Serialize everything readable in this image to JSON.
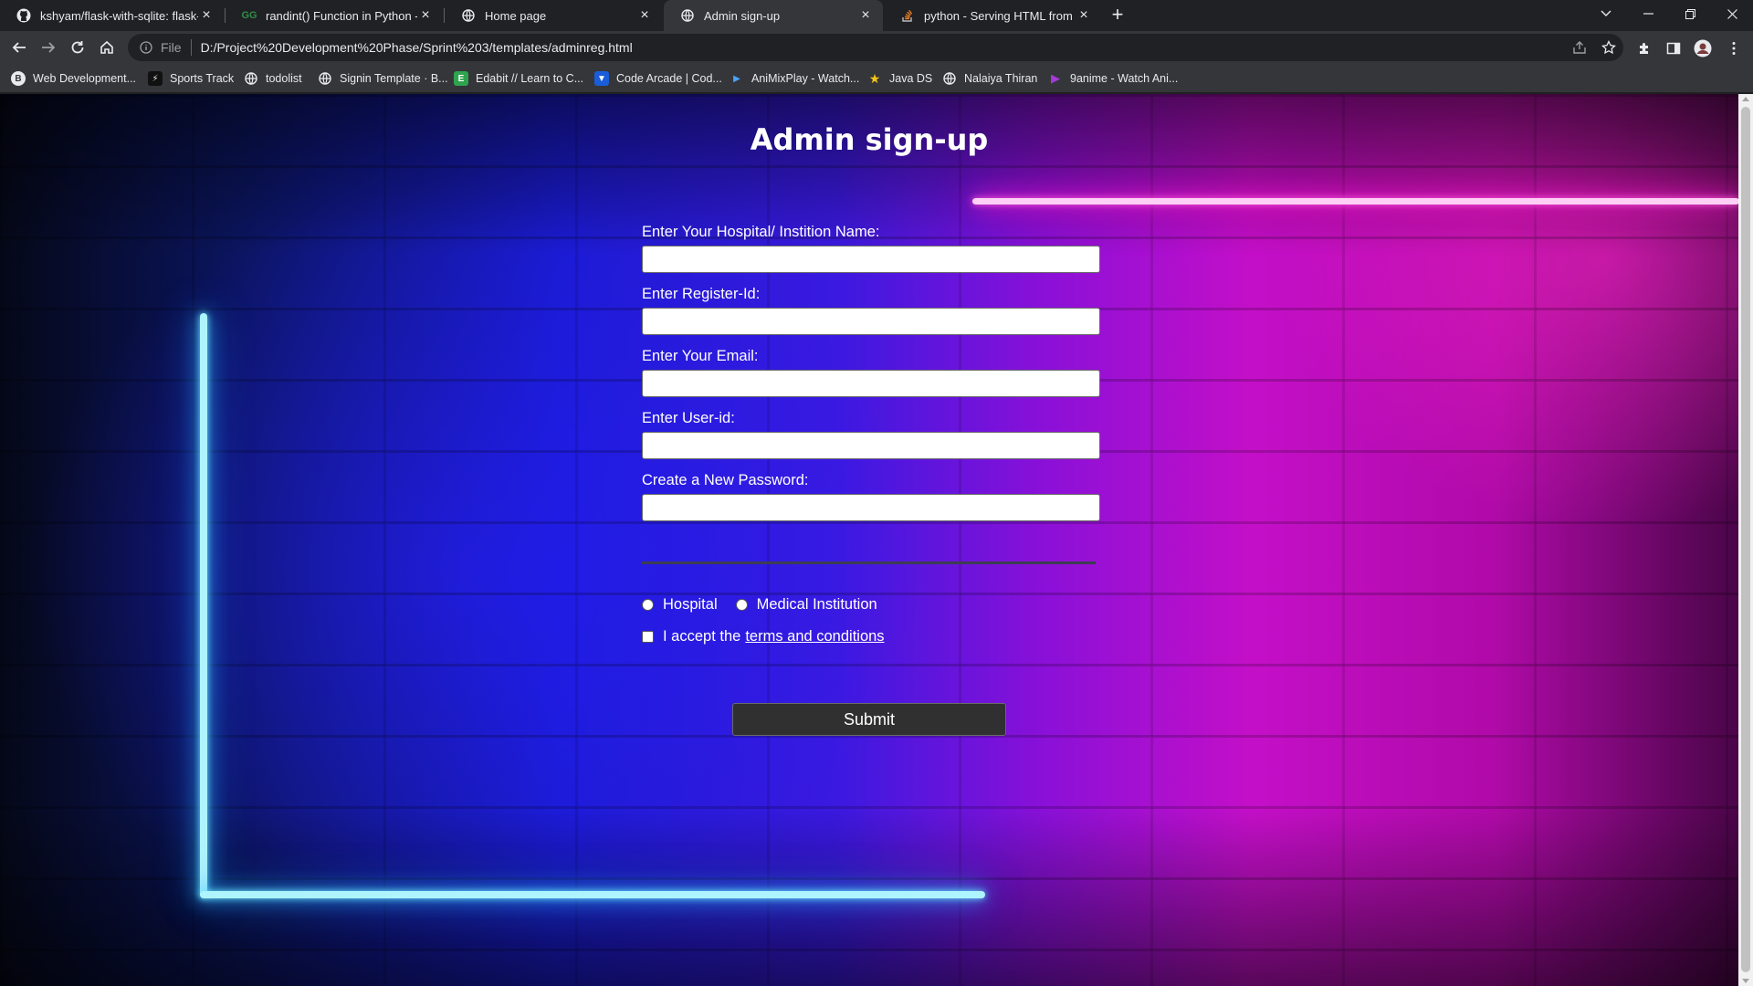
{
  "browser": {
    "tabs": [
      {
        "title": "kshyam/flask-with-sqlite: flask-w",
        "icon": "github-icon",
        "active": false
      },
      {
        "title": "randint() Function in Python - Ge",
        "icon": "geeksforgeeks-icon",
        "active": false
      },
      {
        "title": "Home page",
        "icon": "globe-icon",
        "active": false
      },
      {
        "title": "Admin sign-up",
        "icon": "globe-icon",
        "active": true
      },
      {
        "title": "python - Serving HTML from Flas",
        "icon": "stackoverflow-icon",
        "active": false
      }
    ],
    "address": {
      "scheme_label": "File",
      "url": "D:/Project%20Development%20Phase/Sprint%203/templates/adminreg.html"
    },
    "bookmarks": [
      {
        "label": "Web Development...",
        "icon": "bookmark-icon"
      },
      {
        "label": "Sports Track",
        "icon": "sports-track-icon"
      },
      {
        "label": "todolist",
        "icon": "globe-icon"
      },
      {
        "label": "Signin Template · B...",
        "icon": "globe-icon"
      },
      {
        "label": "Edabit // Learn to C...",
        "icon": "edabit-icon"
      },
      {
        "label": "Code Arcade | Cod...",
        "icon": "code-arcade-icon"
      },
      {
        "label": "AniMixPlay - Watch...",
        "icon": "animixplay-icon"
      },
      {
        "label": "Java DS",
        "icon": "star-icon"
      },
      {
        "label": "Nalaiya Thiran",
        "icon": "globe-icon"
      },
      {
        "label": "9anime - Watch Ani...",
        "icon": "play-icon"
      }
    ]
  },
  "page": {
    "title": "Admin sign-up",
    "fields": [
      {
        "label": "Enter Your Hospital/ Instition Name:",
        "value": ""
      },
      {
        "label": "Enter Register-Id:",
        "value": ""
      },
      {
        "label": "Enter Your Email:",
        "value": ""
      },
      {
        "label": "Enter User-id:",
        "value": ""
      },
      {
        "label": "Create a New Password:",
        "value": ""
      }
    ],
    "radio_options": [
      "Hospital",
      "Medical Institution"
    ],
    "terms": {
      "prefix": "I accept the",
      "link": "terms and conditions"
    },
    "submit_label": "Submit"
  },
  "colors": {
    "neon_blue": "#aef4ff",
    "neon_pink": "#ff1fd0",
    "button_bg": "#303030"
  }
}
